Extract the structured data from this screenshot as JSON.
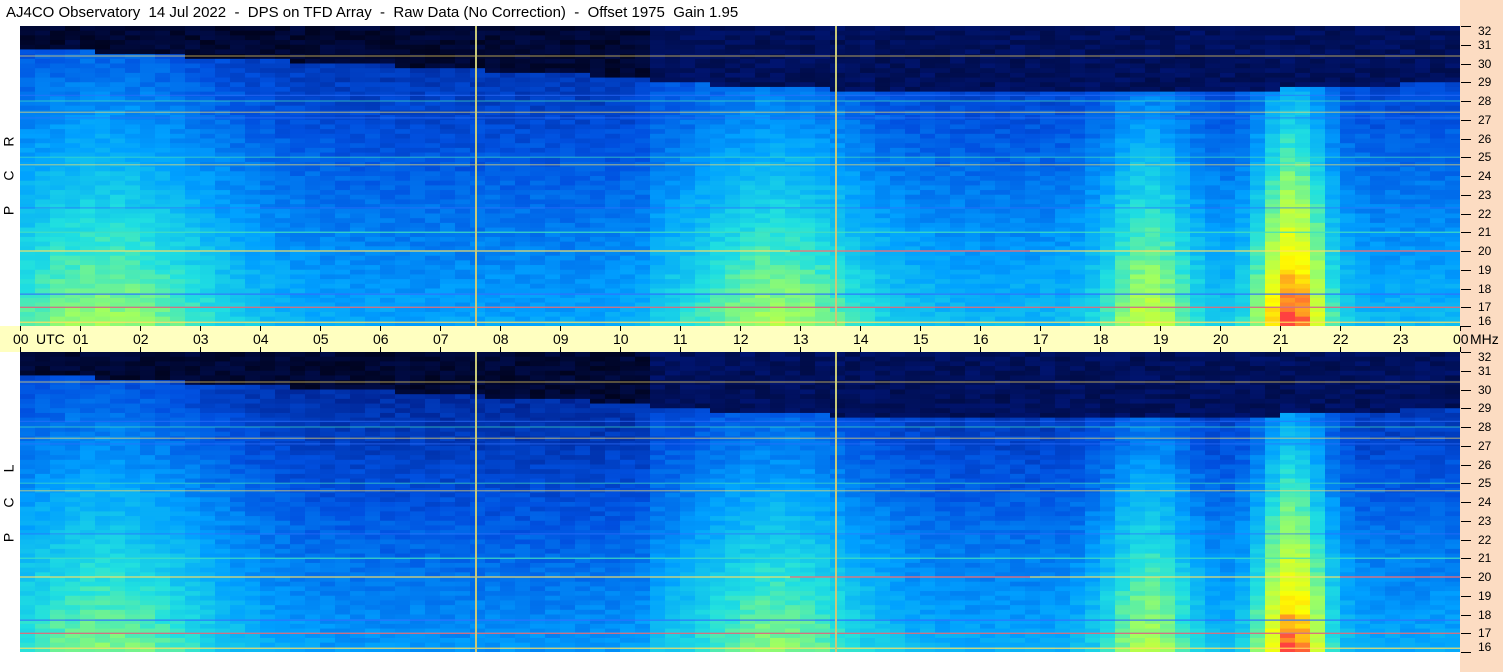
{
  "title": "AJ4CO Observatory  14 Jul 2022  -  DPS on TFD Array  -  Raw Data (No Correction)  -  Offset 1975  Gain 1.95",
  "colors": {
    "background": "#ffffff",
    "time_band": "#ffffc0",
    "freq_axis": "#fcdcc2",
    "marker": "#c8c878",
    "colormap": [
      "#000010",
      "#001880",
      "#0050e0",
      "#00a0ff",
      "#20e0e0",
      "#a0ff60",
      "#ffff00",
      "#ff4040"
    ]
  },
  "chart_data": {
    "type": "heatmap",
    "panels": [
      {
        "polarization": "RCP",
        "label_chars": [
          "R",
          "C",
          "P"
        ]
      },
      {
        "polarization": "LCP",
        "label_chars": [
          "L",
          "C",
          "P"
        ]
      }
    ],
    "x_axis": {
      "unit_label": "UTC",
      "ticks": [
        "00",
        "01",
        "02",
        "03",
        "04",
        "05",
        "06",
        "07",
        "08",
        "09",
        "10",
        "11",
        "12",
        "13",
        "14",
        "15",
        "16",
        "17",
        "18",
        "19",
        "20",
        "21",
        "22",
        "23",
        "00"
      ],
      "range_hours": [
        0,
        24
      ]
    },
    "y_axis": {
      "unit_label": "MHz",
      "ticks": [
        16,
        17,
        18,
        19,
        20,
        21,
        22,
        23,
        24,
        25,
        26,
        27,
        28,
        29,
        30,
        31,
        32
      ],
      "range_mhz": [
        16,
        32
      ]
    },
    "vertical_markers_utc": [
      7.6,
      13.6
    ],
    "sun_rise_utc": 10.5,
    "sun_set_utc": 24,
    "persistent_lines_mhz": [
      16.2,
      17.0,
      17.7,
      20.0,
      21.0,
      22.3,
      24.6,
      25.0,
      27.1,
      27.4,
      28.0,
      28.3,
      30.4
    ],
    "storm_bursts": [
      {
        "utc": 21.2,
        "width_h": 0.6,
        "intensity": 1.0
      },
      {
        "utc": 18.8,
        "width_h": 0.8,
        "intensity": 0.55
      },
      {
        "utc": 1.4,
        "width_h": 2.2,
        "intensity": 0.5
      },
      {
        "utc": 12.6,
        "width_h": 1.6,
        "intensity": 0.45
      }
    ]
  }
}
